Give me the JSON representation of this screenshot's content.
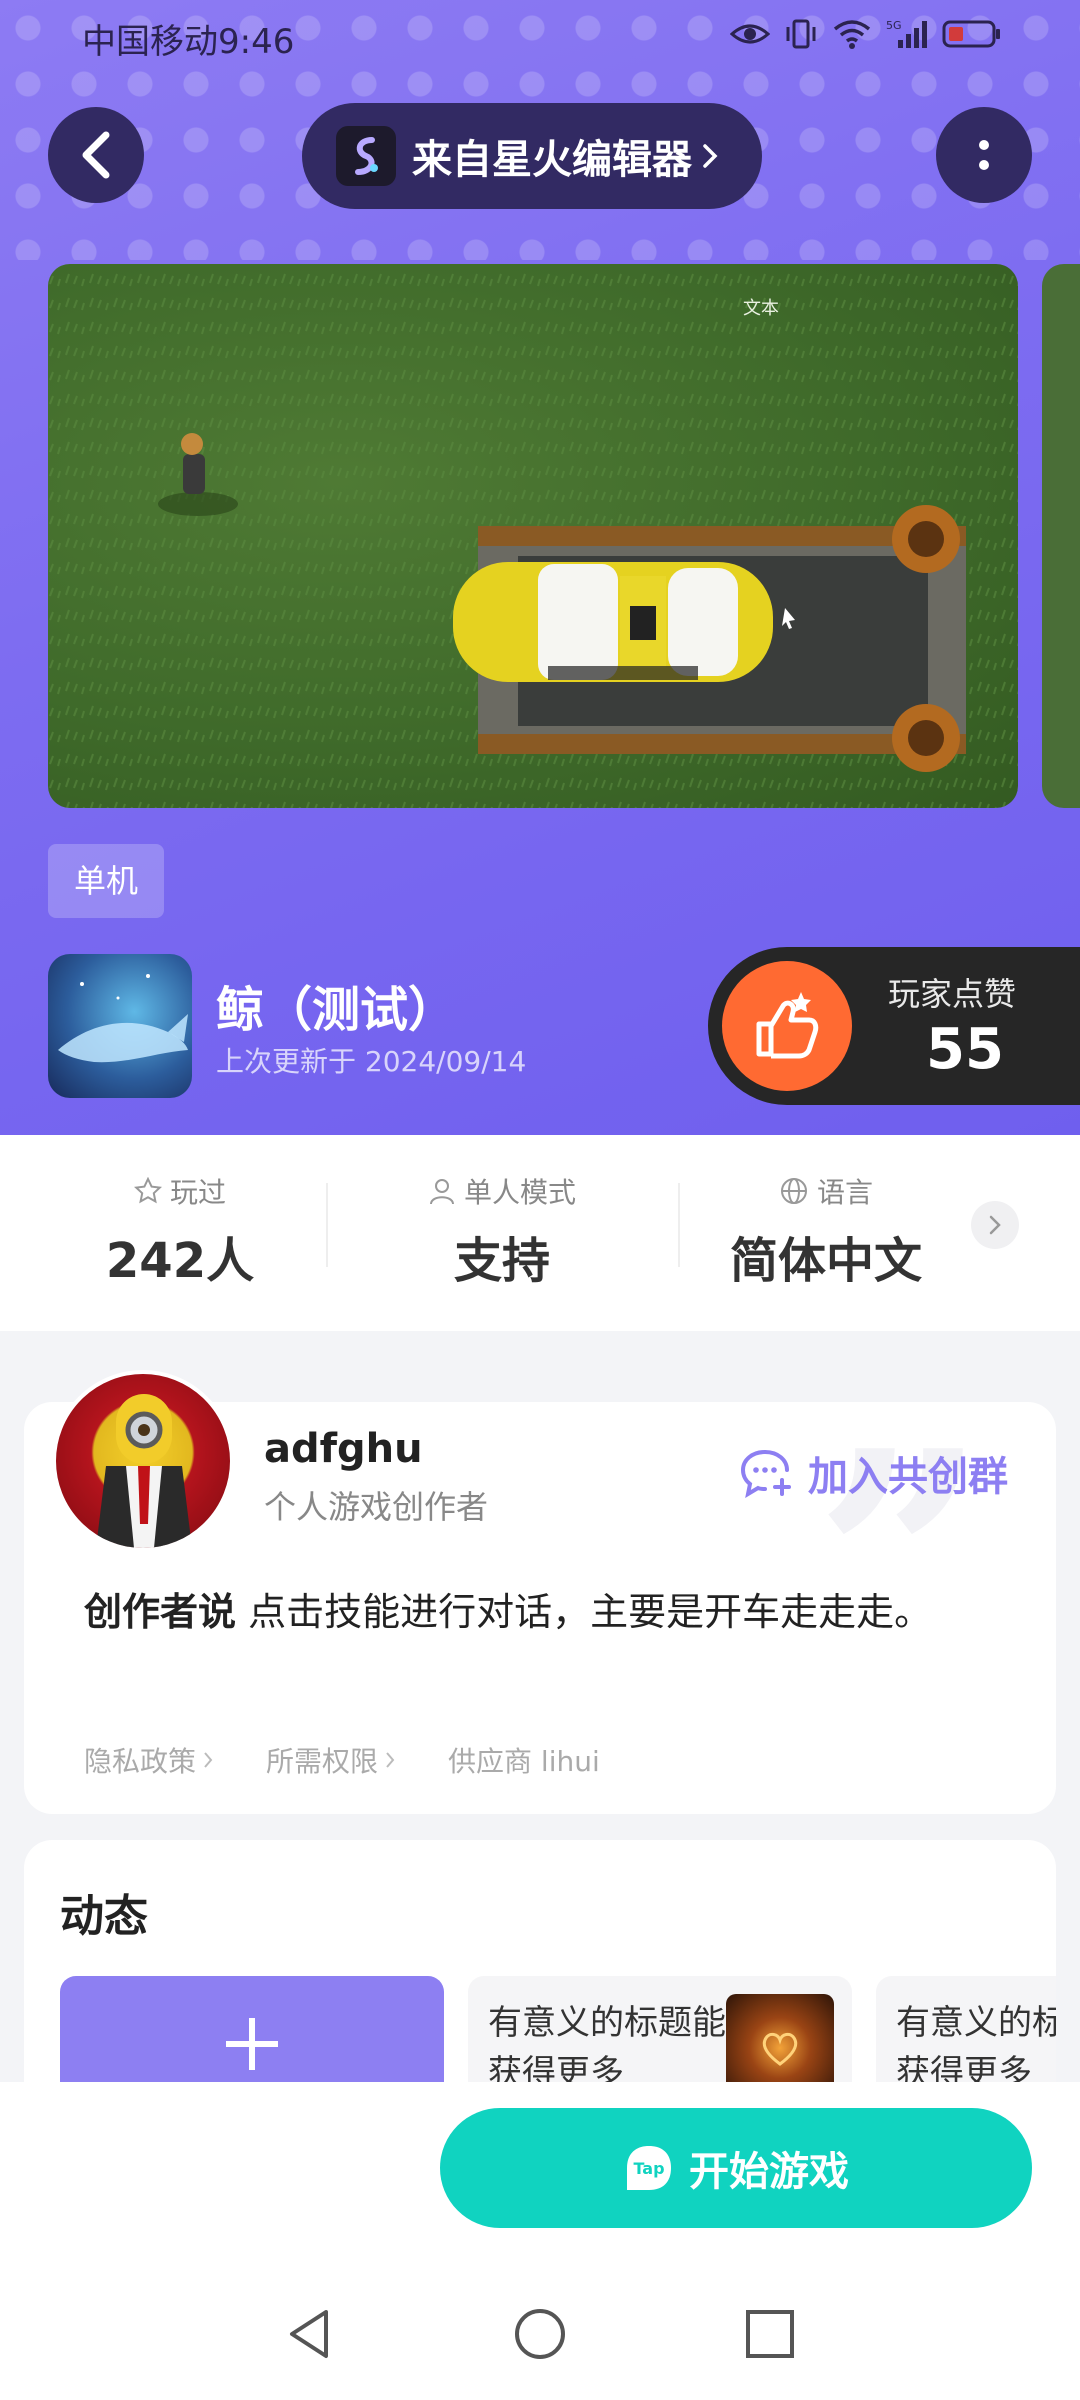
{
  "status_bar": {
    "carrier_time": "中国移动9:46",
    "network": "5G",
    "icons": [
      "eye-icon",
      "vibrate-icon",
      "wifi-icon",
      "signal-icon",
      "battery-icon"
    ]
  },
  "header": {
    "source_label": "来自星火编辑器",
    "back_icon": "back-arrow-icon",
    "more_icon": "more-vertical-icon"
  },
  "gallery": {
    "overlay_text": "文本"
  },
  "game": {
    "tag": "单机",
    "name": "鲸（测试）",
    "updated": "上次更新于 2024/09/14",
    "likes_label": "玩家点赞",
    "likes_count": "55"
  },
  "stats": [
    {
      "icon": "star-icon",
      "label": "玩过",
      "value": "242人"
    },
    {
      "icon": "person-icon",
      "label": "单人模式",
      "value": "支持"
    },
    {
      "icon": "globe-icon",
      "label": "语言",
      "value": "简体中文"
    }
  ],
  "creator": {
    "name": "adfghu",
    "role": "个人游戏创作者",
    "join_group": "加入共创群",
    "say_label": "创作者说",
    "say_text": " 点击技能进行对话，主要是开车走走走。",
    "links": {
      "privacy": "隐私政策",
      "permissions": "所需权限",
      "vendor": "供应商 lihui"
    }
  },
  "feed": {
    "title": "动态",
    "posts": [
      {
        "text": "有意义的标题能获得更多"
      },
      {
        "text": "有意义的标题能获得更多"
      }
    ]
  },
  "bottom": {
    "start_label": "开始游戏",
    "brand": "Tap"
  },
  "colors": {
    "accent": "#8d7ff2",
    "start_button": "#10d3c0",
    "like_orange": "#ff6a32"
  }
}
